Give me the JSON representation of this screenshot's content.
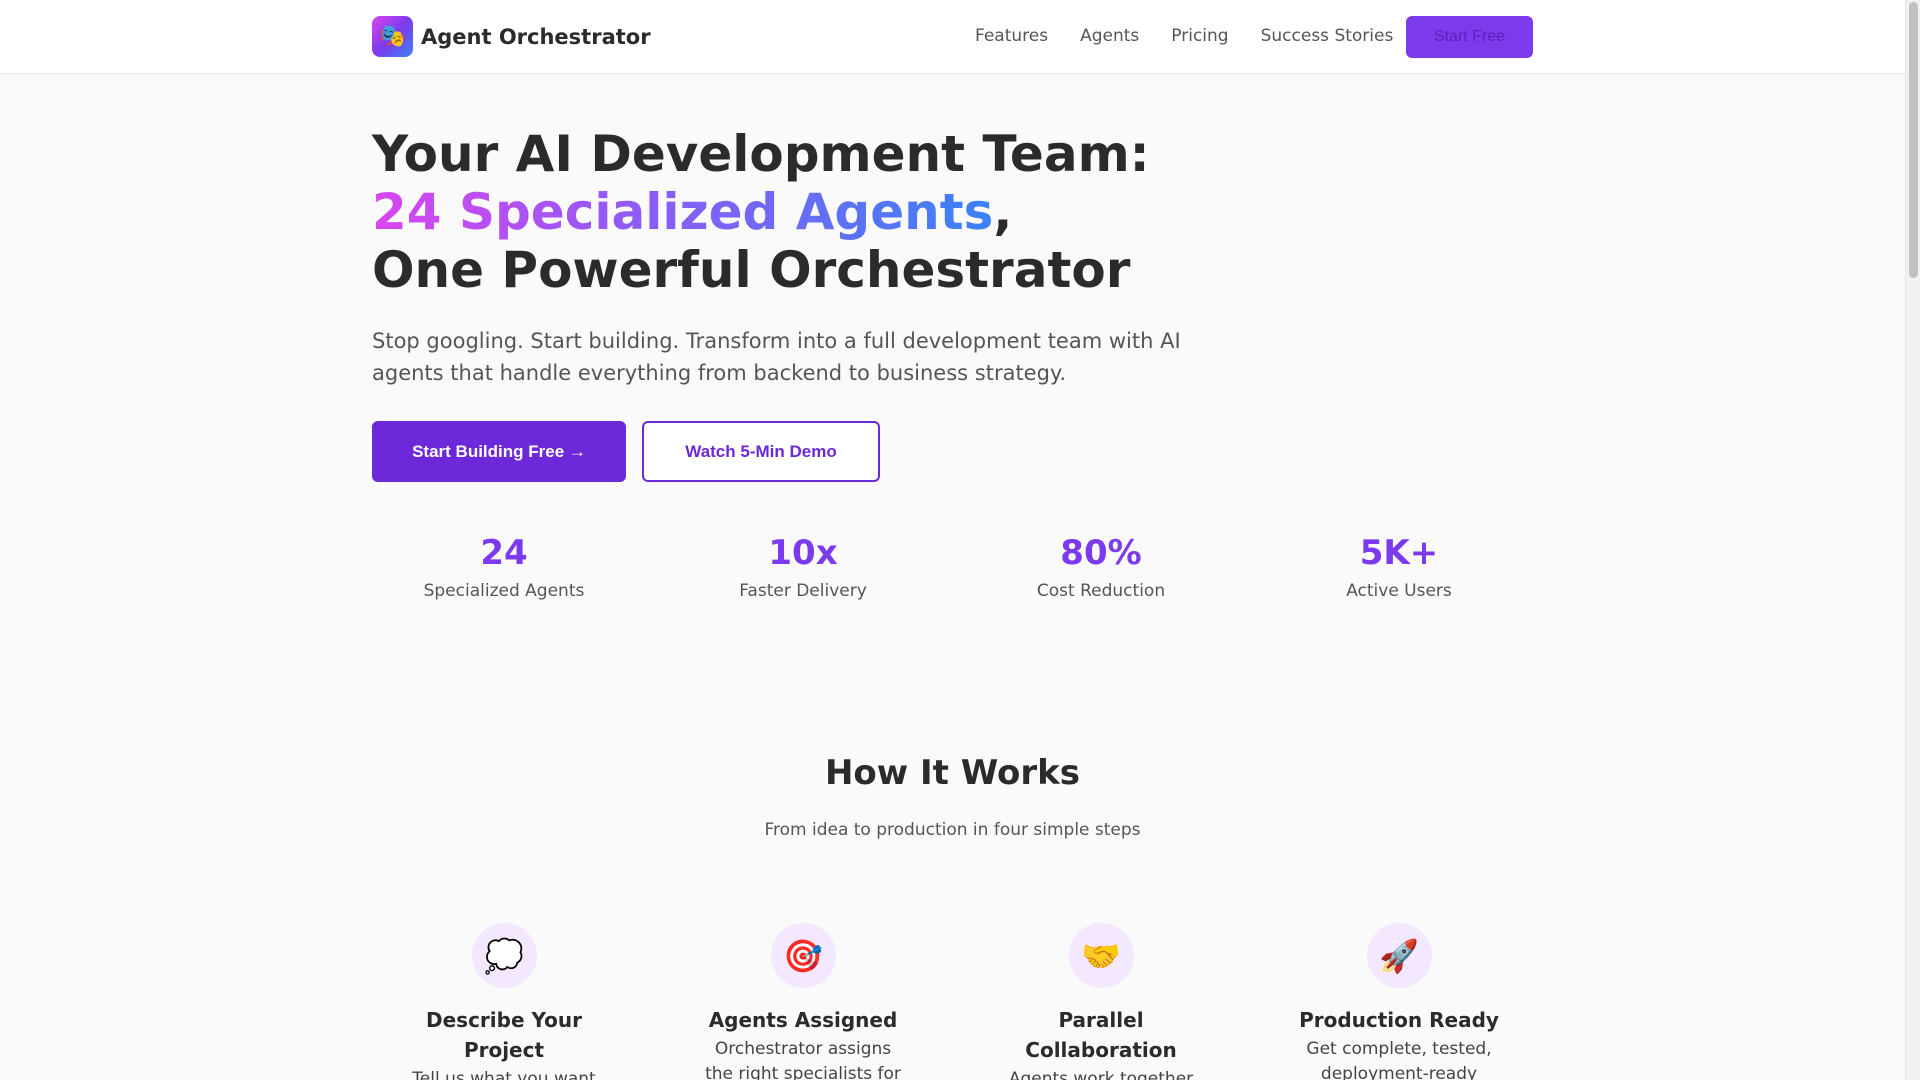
{
  "header": {
    "logo_icon": "🎭",
    "brand_name": "Agent Orchestrator",
    "nav": [
      "Features",
      "Agents",
      "Pricing",
      "Success Stories"
    ],
    "cta_label": "Start Free"
  },
  "hero": {
    "line1": "Your AI Development Team:",
    "highlight": "24 Specialized Agents",
    "comma": ",",
    "line3": "One Powerful Orchestrator",
    "subtitle": "Stop googling. Start building. Transform into a full development team with AI agents that handle everything from backend to business strategy.",
    "primary_cta": "Start Building Free →",
    "secondary_cta": "Watch 5-Min Demo"
  },
  "stats": [
    {
      "value": "24",
      "label": "Specialized Agents"
    },
    {
      "value": "10x",
      "label": "Faster Delivery"
    },
    {
      "value": "80%",
      "label": "Cost Reduction"
    },
    {
      "value": "5K+",
      "label": "Active Users"
    }
  ],
  "how_it_works": {
    "title": "How It Works",
    "subtitle": "From idea to production in four simple steps",
    "steps": [
      {
        "icon": "💭",
        "title": "Describe Your Project",
        "desc": "Tell us what you want to"
      },
      {
        "icon": "🎯",
        "title": "Agents Assigned",
        "desc": "Orchestrator assigns the right specialists for your"
      },
      {
        "icon": "🤝",
        "title": "Parallel Collaboration",
        "desc": "Agents work together"
      },
      {
        "icon": "🚀",
        "title": "Production Ready",
        "desc": "Get complete, tested, deployment-ready code"
      }
    ]
  },
  "colors": {
    "accent": "#7c3aed",
    "accent_dark": "#6d28d9",
    "gradient_start": "#d946ef",
    "gradient_end": "#3b82f6"
  }
}
